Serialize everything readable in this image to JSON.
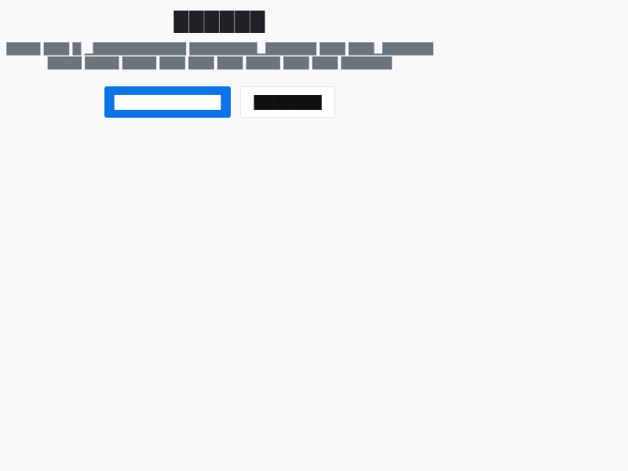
{
  "dialog": {
    "title": "██████",
    "description": "████ ███ █ ▁███████████ ████████▁██████ ███ ███▁██████ ████ ████ ████ ███ ███ ███ ████ ███ ███ ██████",
    "primary_button_label": "███████████",
    "secondary_button_label": "███████"
  },
  "colors": {
    "background": "#f8f9fa",
    "primary": "#0b74e6",
    "title": "#202124",
    "text": "#6c757d",
    "secondary_border": "#e1e4e8"
  }
}
